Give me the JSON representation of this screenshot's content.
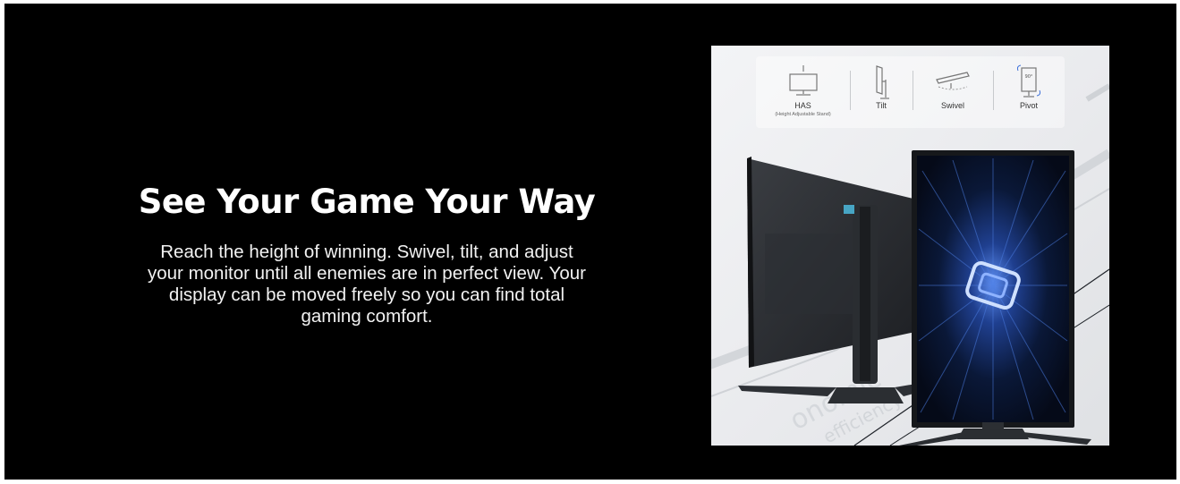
{
  "headline": "See Your Game Your Way",
  "body": "Reach the height of winning. Swivel, tilt, and adjust your monitor until all enemies are in perfect view. Your display can be moved freely so you can find total gaming comfort.",
  "features": [
    {
      "label": "HAS",
      "sublabel": "(Height Adjustable Stand)",
      "icon": "height-adjust-icon"
    },
    {
      "label": "Tilt",
      "sublabel": "",
      "icon": "tilt-icon"
    },
    {
      "label": "Swivel",
      "sublabel": "",
      "icon": "swivel-icon"
    },
    {
      "label": "Pivot",
      "sublabel": "",
      "icon": "pivot-icon"
    }
  ],
  "pivot_badge": "90°",
  "colors": {
    "background": "#000000",
    "text": "#ffffff",
    "screen_accent": "#3b6fd9"
  }
}
